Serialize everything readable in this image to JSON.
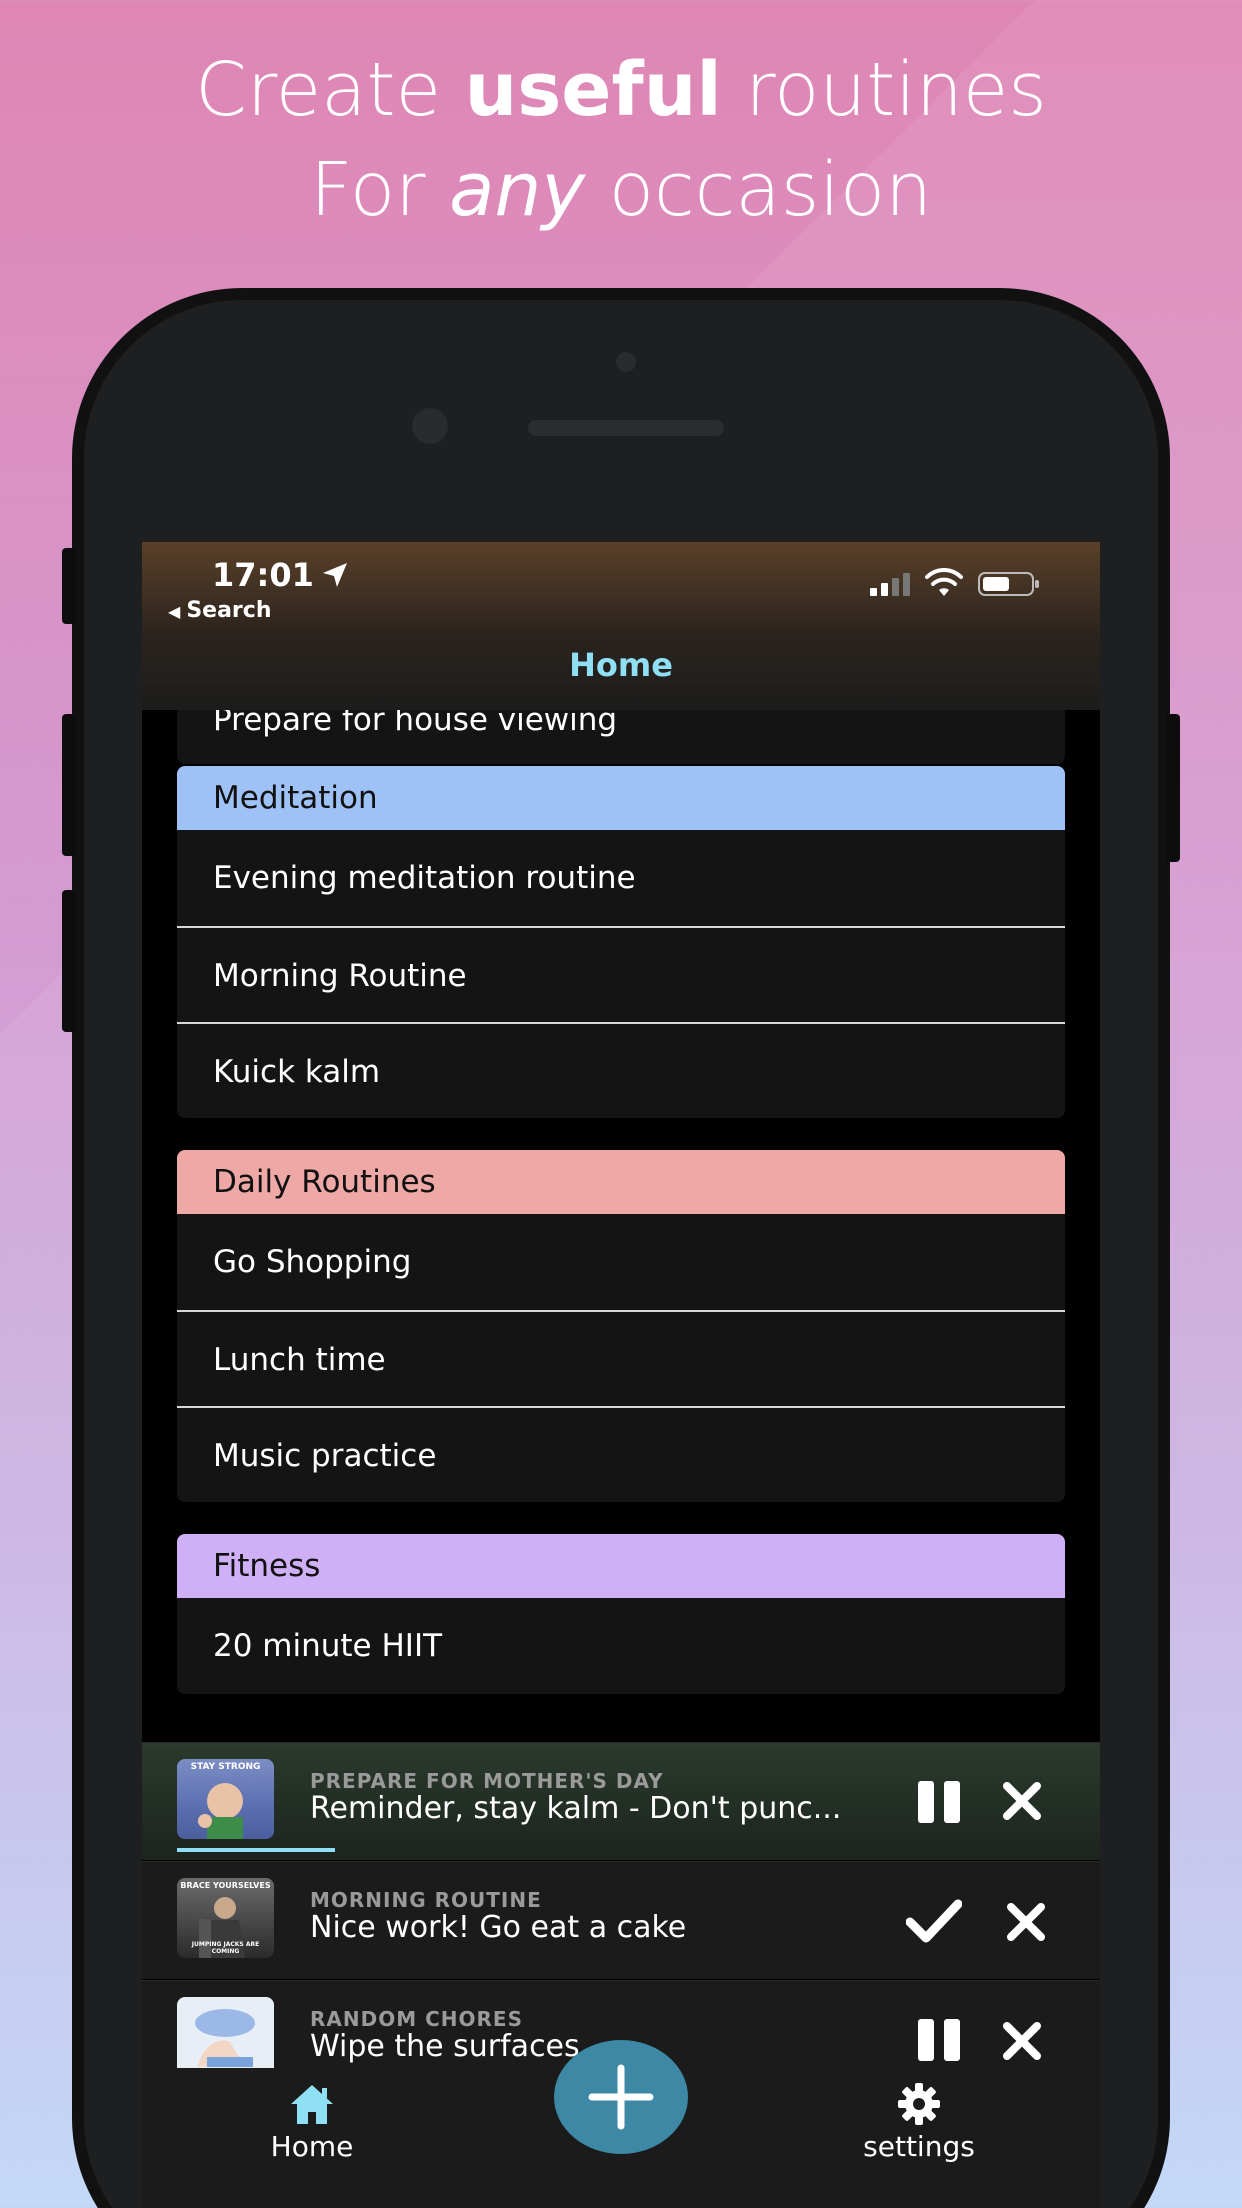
{
  "headline": {
    "line1_pre": "Create ",
    "line1_bold": "useful",
    "line1_post": " routines",
    "line2_pre": "For ",
    "line2_italic": "any",
    "line2_post": " occasion"
  },
  "status_bar": {
    "time": "17:01",
    "back_label": "Search"
  },
  "nav": {
    "title": "Home"
  },
  "partial_item": "Prepare for house viewing",
  "groups": [
    {
      "title": "Meditation",
      "color": "#9fc2f6",
      "items": [
        "Evening meditation routine",
        "Morning Routine",
        "Kuick kalm"
      ]
    },
    {
      "title": "Daily Routines",
      "color": "#eea8a6",
      "items": [
        "Go Shopping",
        "Lunch time",
        "Music practice"
      ]
    },
    {
      "title": "Fitness",
      "color": "#cfb0f6",
      "items": [
        "20 minute HIIT"
      ]
    }
  ],
  "now_playing": [
    {
      "routine": "PREPARE FOR MOTHER'S DAY",
      "step": "Reminder, stay kalm - Don't punc...",
      "thumb_caption": "STAY STRONG",
      "action_icon": "pause-icon",
      "progress": 0.12
    },
    {
      "routine": "MORNING ROUTINE",
      "step": "Nice work! Go eat a cake",
      "thumb_caption_top": "BRACE YOURSELVES",
      "thumb_caption_bottom": "JUMPING JACKS ARE COMING",
      "action_icon": "check-icon",
      "progress": 0
    },
    {
      "routine": "RANDOM CHORES",
      "step": "Wipe the surfaces",
      "action_icon": "pause-icon",
      "progress": 0.02
    }
  ],
  "tab_bar": {
    "home_label": "Home",
    "settings_label": "settings",
    "add_icon": "plus-icon"
  },
  "colors": {
    "accent": "#8fe0f4",
    "fab": "#3c88a5"
  }
}
